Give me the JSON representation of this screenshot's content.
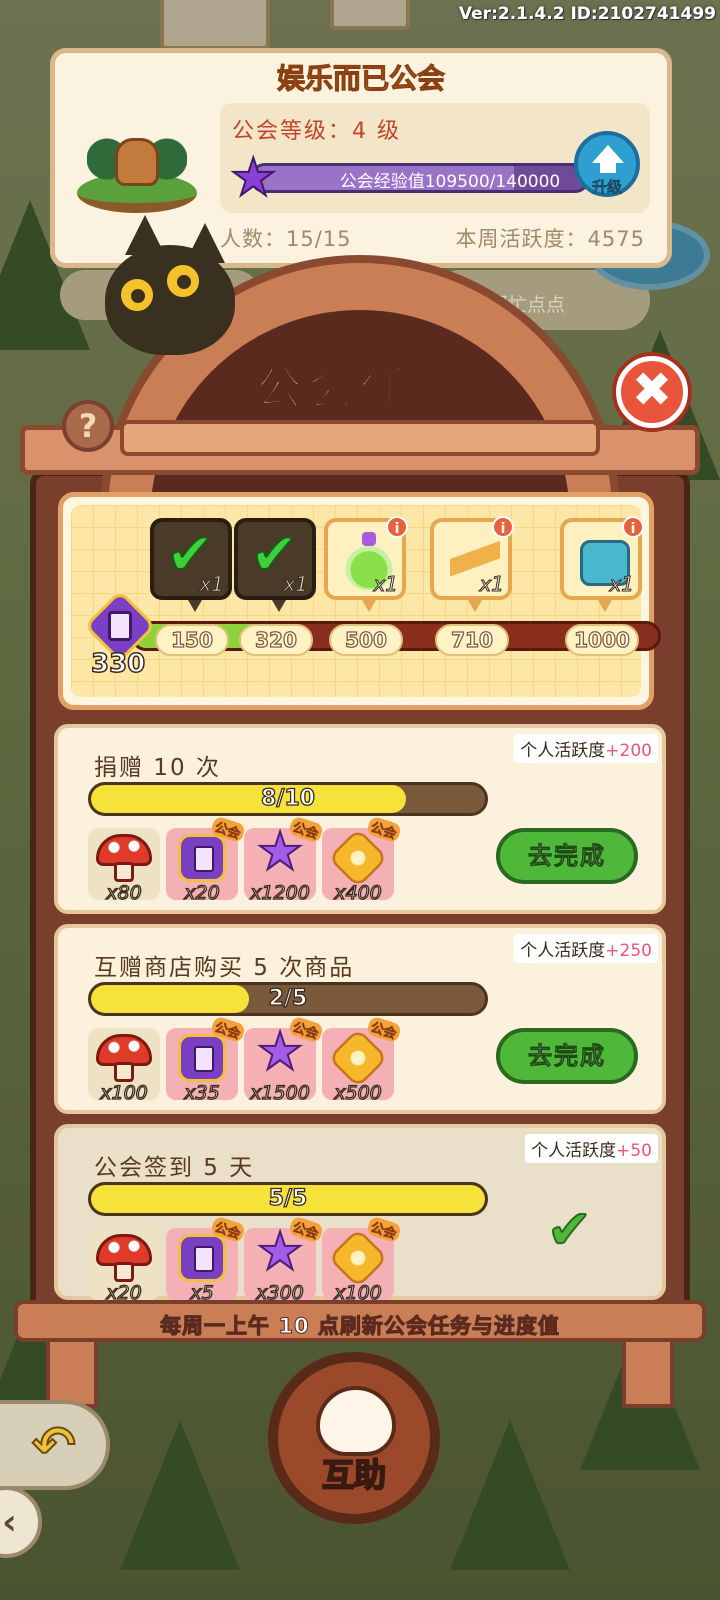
{
  "status": {
    "version": "Ver:2.1.4.2 ID:2102741499"
  },
  "guild": {
    "name": "娱乐而已公会",
    "level": "公会等级：4 级",
    "exp": "公会经验值109500/140000",
    "exp_progress": 0.78,
    "upgrade_label": "升级",
    "members": "人数：15/15",
    "weekly_activity": "本周活跃度：4575",
    "hint": "帮帮忙点点"
  },
  "panel": {
    "title": "公会任务",
    "help_label": "?",
    "close_label": "✖",
    "footer": "每周一上午 10 点刷新公会任务与进度值"
  },
  "milestones": {
    "current": "330",
    "progress": 0.33,
    "items": [
      {
        "threshold": "150",
        "qty": "x1",
        "icon": "chest-icon",
        "claimed": true
      },
      {
        "threshold": "320",
        "qty": "x1",
        "icon": "potion-icon",
        "claimed": true
      },
      {
        "threshold": "500",
        "qty": "x1",
        "icon": "potion-icon",
        "claimed": false
      },
      {
        "threshold": "710",
        "qty": "x1",
        "icon": "scroll-icon",
        "claimed": false
      },
      {
        "threshold": "1000",
        "qty": "x1",
        "icon": "chest-icon",
        "claimed": false
      }
    ]
  },
  "tasks": [
    {
      "title": "捐赠 10 次",
      "activity_label": "个人活跃度",
      "activity_bonus": "+200",
      "progress_text": "8/10",
      "progress": 0.8,
      "button": "去完成",
      "rewards": [
        {
          "icon": "mushroom-icon",
          "qty": "x80",
          "guild": false
        },
        {
          "icon": "task-badge-icon",
          "qty": "x20",
          "guild": true
        },
        {
          "icon": "star-icon",
          "qty": "x1200",
          "guild": true
        },
        {
          "icon": "paw-coin-icon",
          "qty": "x400",
          "guild": true
        }
      ]
    },
    {
      "title": "互赠商店购买 5 次商品",
      "activity_label": "个人活跃度",
      "activity_bonus": "+250",
      "progress_text": "2/5",
      "progress": 0.4,
      "button": "去完成",
      "rewards": [
        {
          "icon": "mushroom-icon",
          "qty": "x100",
          "guild": false
        },
        {
          "icon": "task-badge-icon",
          "qty": "x35",
          "guild": true
        },
        {
          "icon": "star-icon",
          "qty": "x1500",
          "guild": true
        },
        {
          "icon": "paw-coin-icon",
          "qty": "x500",
          "guild": true
        }
      ]
    },
    {
      "title": "公会签到 5 天",
      "activity_label": "个人活跃度",
      "activity_bonus": "+50",
      "progress_text": "5/5",
      "progress": 1.0,
      "button": "",
      "rewards": [
        {
          "icon": "mushroom-icon",
          "qty": "x20",
          "guild": false
        },
        {
          "icon": "task-badge-icon",
          "qty": "x5",
          "guild": true
        },
        {
          "icon": "star-icon",
          "qty": "x300",
          "guild": true
        },
        {
          "icon": "paw-coin-icon",
          "qty": "x100",
          "guild": true
        }
      ]
    }
  ],
  "guild_tag": "公会",
  "bottom": {
    "mutual_help": "互助"
  },
  "colors": {
    "accent_green": "#4fb83a",
    "bonus_pink": "#e8567a",
    "progress_yellow": "#f6e33a",
    "frame_brown": "#7a3f2c"
  }
}
